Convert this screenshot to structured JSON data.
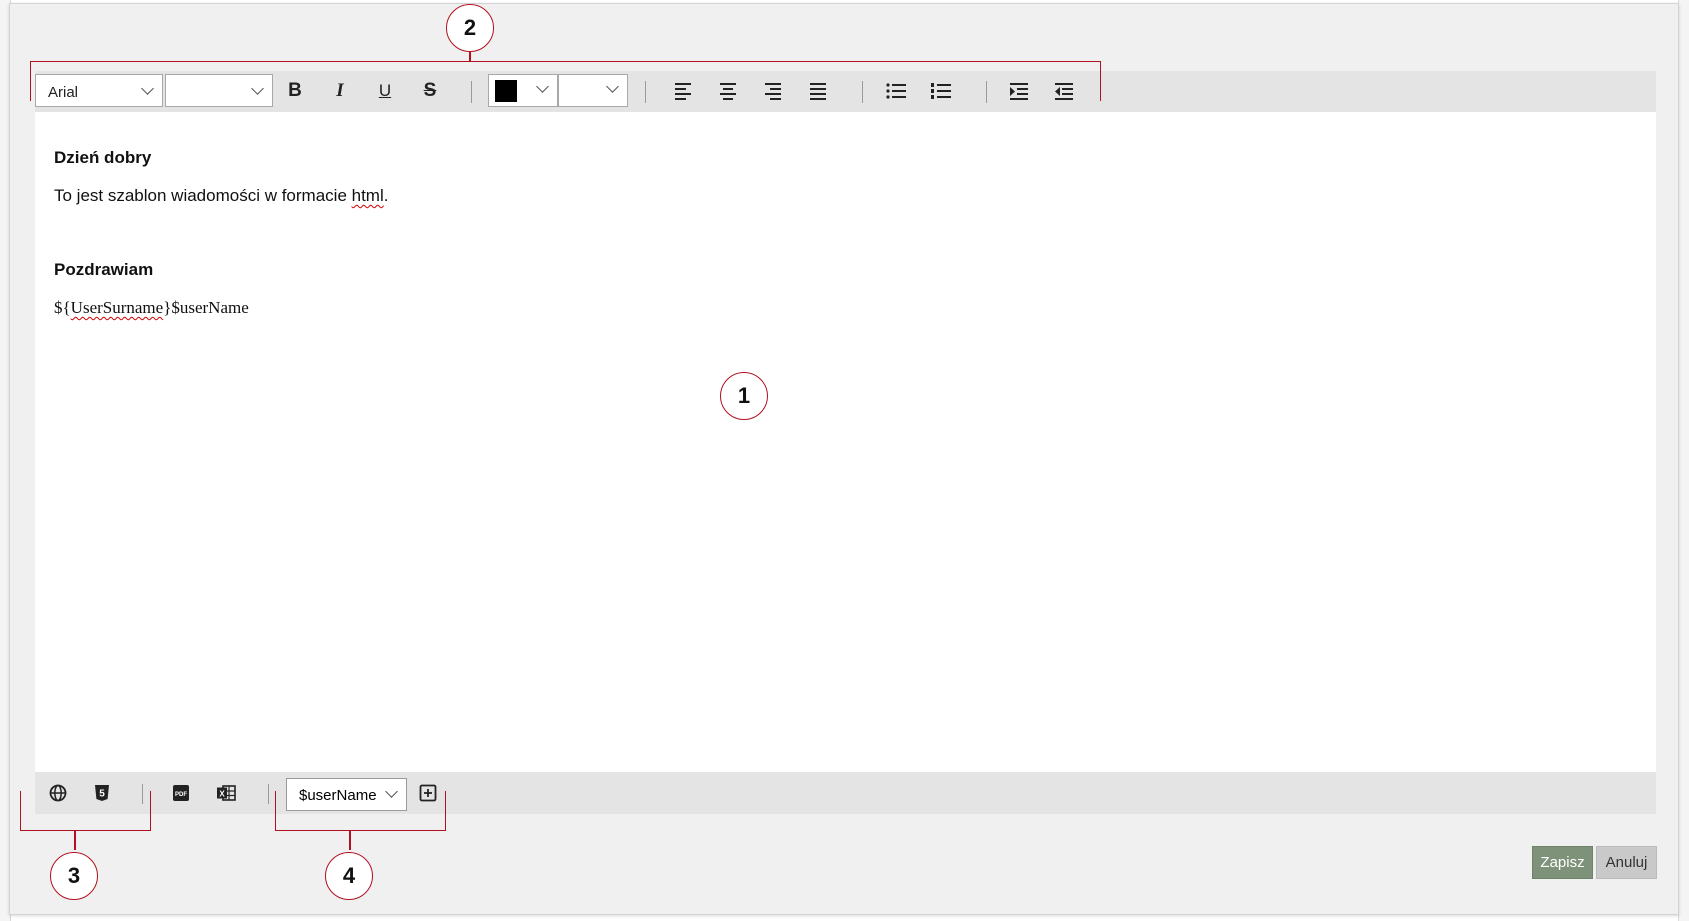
{
  "toolbar": {
    "font_family": "Arial",
    "font_size": "",
    "text_color": "#000000",
    "highlight_color": "#ffffff",
    "icons": [
      "bold-icon",
      "italic-icon",
      "underline-icon",
      "strikethrough-icon",
      "align-left-icon",
      "align-center-icon",
      "align-right-icon",
      "justify-icon",
      "bullet-list-icon",
      "numbered-list-icon",
      "indent-icon",
      "outdent-icon"
    ]
  },
  "editor": {
    "greeting": "Dzień dobry",
    "body_before": "To jest szablon wiadomości w formacie ",
    "body_word": "html",
    "body_after": ".",
    "closing": "Pozdrawiam",
    "sig_prefix": "${",
    "sig_var": "UserSurname",
    "sig_suffix": "}$userName"
  },
  "bottom_bar": {
    "variable_selected": "$userName",
    "pdf_label": "PDF",
    "xls_label": "X",
    "html_label": "5"
  },
  "buttons": {
    "save": "Zapisz",
    "cancel": "Anuluj"
  },
  "annotations": {
    "a1": "1",
    "a2": "2",
    "a3": "3",
    "a4": "4"
  },
  "colors": {
    "save_bg": "#7d9279",
    "cancel_bg": "#c9c9c9",
    "annotation_red": "#b01020"
  }
}
